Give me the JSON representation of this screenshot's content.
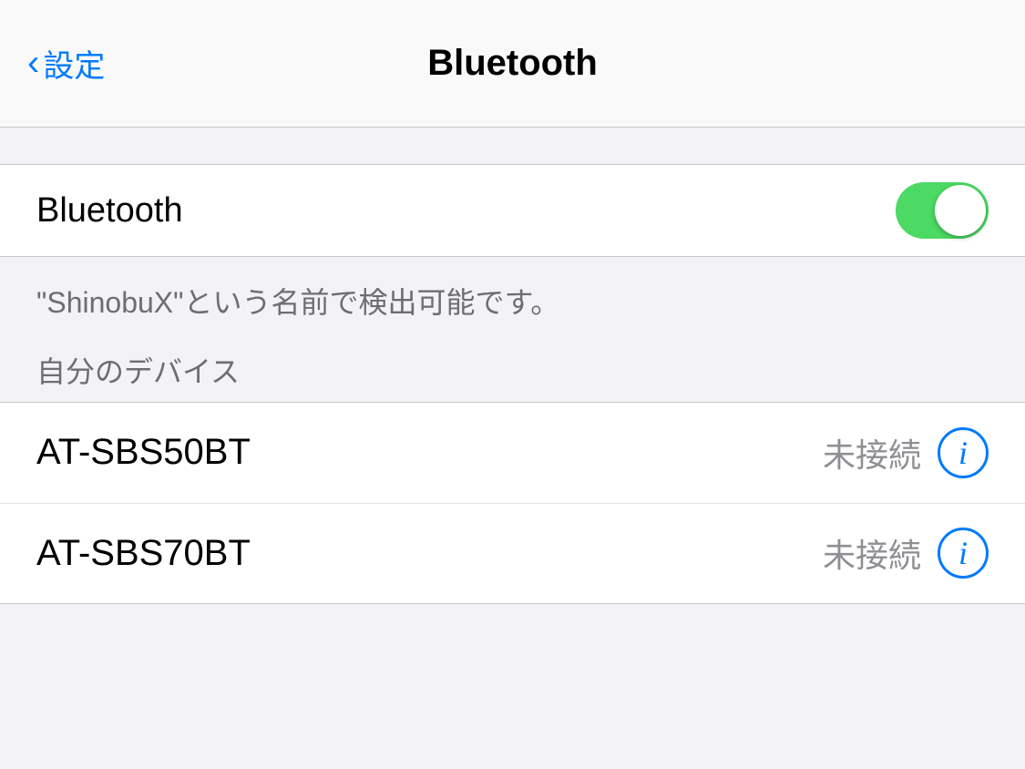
{
  "nav": {
    "back_label": "設定",
    "title": "Bluetooth"
  },
  "bluetooth_row": {
    "label": "Bluetooth",
    "toggle_on": true
  },
  "info_text": "\"ShinobuX\"という名前で検出可能です。",
  "section_header": "自分のデバイス",
  "devices": [
    {
      "name": "AT-SBS50BT",
      "status": "未接続"
    },
    {
      "name": "AT-SBS70BT",
      "status": "未接続"
    }
  ],
  "colors": {
    "toggle_on": "#4cd964",
    "blue": "#007aff"
  }
}
